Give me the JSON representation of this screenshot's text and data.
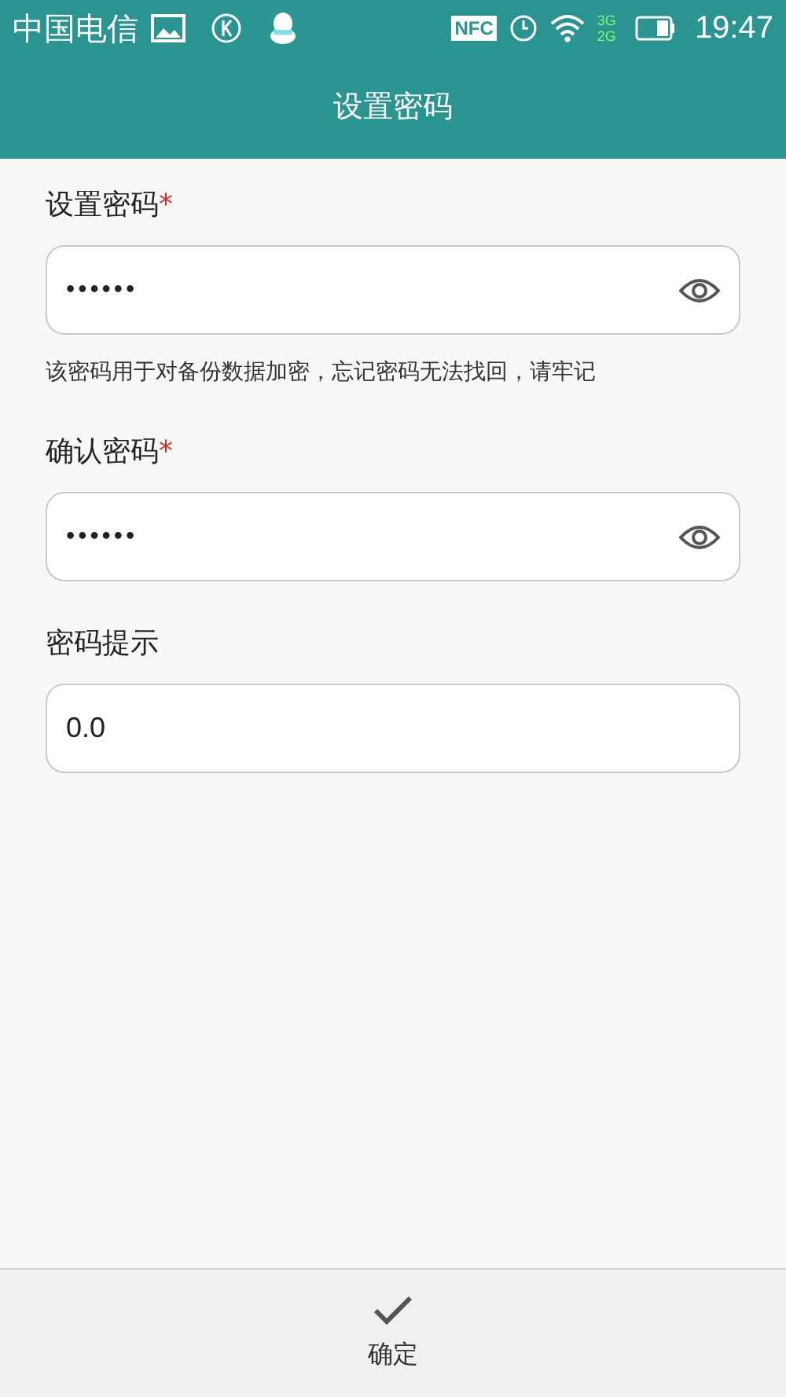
{
  "status_bar": {
    "carrier": "中国电信",
    "nfc": "NFC",
    "network_top": "3G",
    "network_bottom": "2G",
    "time": "19:47"
  },
  "title": "设置密码",
  "fields": [
    {
      "label": "设置密码",
      "required_mark": "*",
      "value": "••••••",
      "reveal": true,
      "hint": "该密码用于对备份数据加密，忘记密码无法找回，请牢记"
    },
    {
      "label": "确认密码",
      "required_mark": "*",
      "value": "••••••",
      "reveal": true
    },
    {
      "label": "密码提示",
      "value": "0.0",
      "reveal": false
    }
  ],
  "confirm_button": "确定"
}
